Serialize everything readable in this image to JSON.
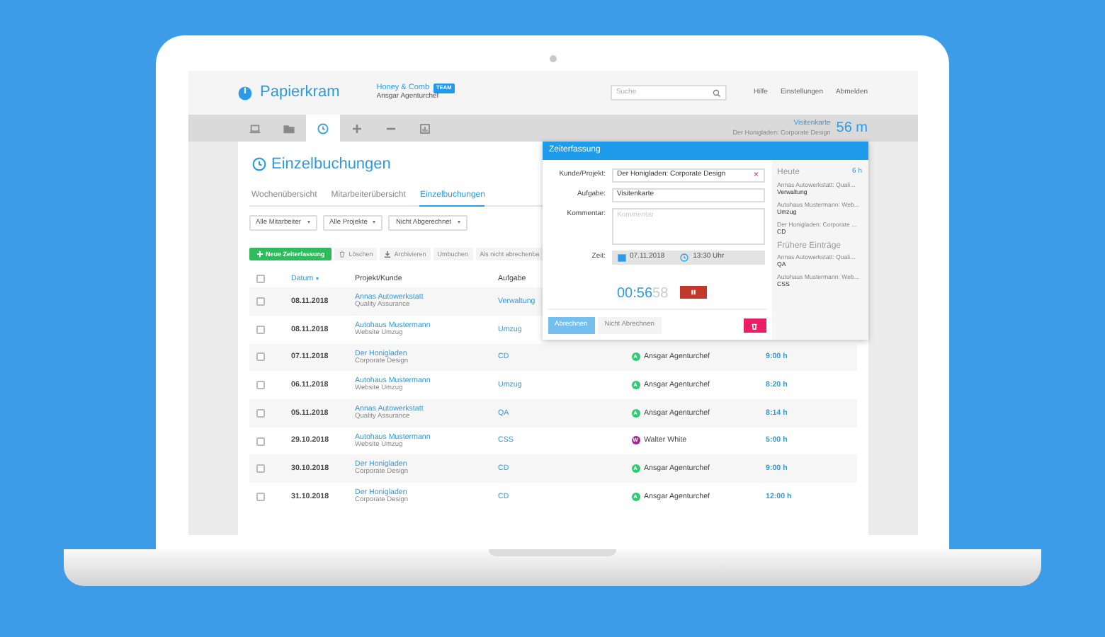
{
  "header": {
    "logo": "Papierkram",
    "company": "Honey & Comb",
    "badge": "TEAM",
    "user": "Ansgar Agenturchef",
    "search": {
      "placeholder": "Suche"
    },
    "links": [
      "Hilfe",
      "Einstellungen",
      "Abmelden"
    ]
  },
  "toolbar": {
    "tabs": [
      {
        "kind": "laptop",
        "selected": false
      },
      {
        "kind": "folder",
        "selected": false
      },
      {
        "kind": "clock",
        "selected": true
      },
      {
        "kind": "plus",
        "selected": false
      },
      {
        "kind": "minus",
        "selected": false
      },
      {
        "kind": "chart",
        "selected": false
      }
    ],
    "running": {
      "task": "Visitenkarte",
      "project": "Der Honigladen: Corporate Design",
      "duration": "56 m"
    }
  },
  "page": {
    "title": "Einzelbuchungen",
    "tabs": [
      {
        "label": "Wochenübersicht",
        "selected": false
      },
      {
        "label": "Mitarbeiterübersicht",
        "selected": false
      },
      {
        "label": "Einzelbuchungen",
        "selected": true
      }
    ],
    "filters": [
      "Alle Mitarbeiter",
      "Alle Projekte",
      "Nicht Abgerechnet"
    ],
    "actions": [
      {
        "label": "Neue Zeiterfassung",
        "kind": "primary"
      },
      {
        "label": "Löschen",
        "kind": "trash"
      },
      {
        "label": "Archivieren",
        "kind": "download"
      },
      {
        "label": "Umbuchen",
        "kind": "plain"
      },
      {
        "label": "Als nicht abrechenba",
        "kind": "plain"
      }
    ]
  },
  "table": {
    "all_checked": false,
    "columns": [
      {
        "label": "Datum",
        "sorted": true
      },
      {
        "label": "Projekt/Kunde",
        "sorted": false
      },
      {
        "label": "Aufgabe",
        "sorted": false
      }
    ],
    "rows": [
      {
        "checked": false,
        "date": "08.11.2018",
        "project": "Annas Autowerkstatt",
        "subproject": "Quality Assurance",
        "task": "Verwaltung"
      },
      {
        "checked": false,
        "date": "08.11.2018",
        "project": "Autohaus Mustermann",
        "subproject": "Website Umzug",
        "task": "Umzug"
      },
      {
        "checked": false,
        "date": "07.11.2018",
        "project": "Der Honigladen",
        "subproject": "Corporate Design",
        "task": "CD",
        "user": {
          "initial": "A",
          "name": "Ansgar Agenturchef",
          "color": "#2ecc71"
        },
        "duration": "9:00 h"
      },
      {
        "checked": false,
        "date": "06.11.2018",
        "project": "Autohaus Mustermann",
        "subproject": "Website Umzug",
        "task": "Umzug",
        "user": {
          "initial": "A",
          "name": "Ansgar Agenturchef",
          "color": "#2ecc71"
        },
        "duration": "8:20 h"
      },
      {
        "checked": false,
        "date": "05.11.2018",
        "project": "Annas Autowerkstatt",
        "subproject": "Quality Assurance",
        "task": "QA",
        "user": {
          "initial": "A",
          "name": "Ansgar Agenturchef",
          "color": "#2ecc71"
        },
        "duration": "8:14 h"
      },
      {
        "checked": false,
        "date": "29.10.2018",
        "project": "Autohaus Mustermann",
        "subproject": "Website Umzug",
        "task": "CSS",
        "user": {
          "initial": "W",
          "name": "Walter White",
          "color": "#9b2c8f"
        },
        "duration": "5:00 h"
      },
      {
        "checked": false,
        "date": "30.10.2018",
        "project": "Der Honigladen",
        "subproject": "Corporate Design",
        "task": "CD",
        "user": {
          "initial": "A",
          "name": "Ansgar Agenturchef",
          "color": "#2ecc71"
        },
        "duration": "9:00 h"
      },
      {
        "checked": false,
        "date": "31.10.2018",
        "project": "Der Honigladen",
        "subproject": "Corporate Design",
        "task": "CD",
        "user": {
          "initial": "A",
          "name": "Ansgar Agenturchef",
          "color": "#2ecc71"
        },
        "duration": "12:00 h"
      }
    ]
  },
  "popup": {
    "title": "Zeiterfassung",
    "fields": [
      {
        "label": "Kunde/Projekt:",
        "kind": "select",
        "value": "Der Honigladen: Corporate Design",
        "clear": "×"
      },
      {
        "label": "Aufgabe:",
        "kind": "text",
        "value": "Visitenkarte"
      },
      {
        "label": "Kommentar:",
        "kind": "textarea",
        "placeholder": "Kommentar"
      }
    ],
    "time": {
      "label": "Zeit:",
      "date": "07.11.2018",
      "clock": "13:30 Uhr"
    },
    "timer": {
      "elapsed": "00:56",
      "seconds": "58"
    },
    "billing": [
      {
        "label": "Abrechnen",
        "selected": true
      },
      {
        "label": "Nicht Abrechnen",
        "selected": false
      }
    ],
    "today": {
      "title": "Heute",
      "total": "6 h",
      "entries": [
        {
          "project": "Annas Autowerkstatt: Quali...",
          "task": "Verwaltung"
        },
        {
          "project": "Autohaus Mustermann: Web...",
          "task": "Umzug"
        },
        {
          "project": "Der Honigladen: Corporate ...",
          "task": "CD"
        }
      ]
    },
    "earlier": {
      "title": "Frühere Einträge",
      "entries": [
        {
          "project": "Annas Autowerkstatt: Quali...",
          "task": "QA"
        },
        {
          "project": "Autohaus Mustermann: Web...",
          "task": "CSS"
        }
      ]
    }
  }
}
